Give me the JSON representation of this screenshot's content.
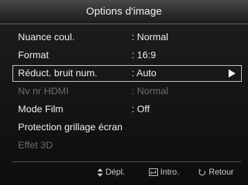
{
  "window": {
    "title": "Options d'image"
  },
  "menu": [
    {
      "label": "Nuance coul.",
      "value": ": Normal",
      "state": "normal"
    },
    {
      "label": "Format",
      "value": ": 16:9",
      "state": "normal"
    },
    {
      "label": "Réduct. bruit num.",
      "value": ": Auto",
      "state": "selected"
    },
    {
      "label": "Nv nr HDMI",
      "value": ": Normal",
      "state": "disabled"
    },
    {
      "label": "Mode Film",
      "value": ": Off",
      "state": "normal"
    },
    {
      "label": "Protection grillage écran",
      "value": "",
      "state": "normal"
    },
    {
      "label": "Effet 3D",
      "value": "",
      "state": "disabled"
    }
  ],
  "footer": {
    "move_label": "Dépl.",
    "enter_label": "Intro.",
    "return_label": "Retour",
    "move_icon": "updown-arrows-icon",
    "enter_icon": "enter-icon",
    "return_icon": "return-icon"
  }
}
